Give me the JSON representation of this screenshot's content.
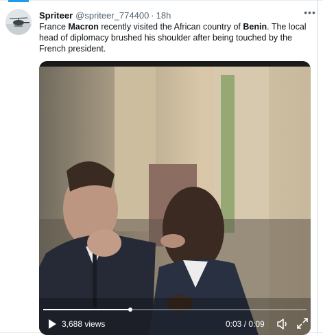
{
  "tweet": {
    "author_name": "Spriteer",
    "handle": "@spriteer_774400",
    "separator": "·",
    "time": "18h",
    "more_icon": "ellipsis-icon",
    "text_parts": {
      "p1": "France ",
      "b1": "Macron",
      "p2": " recently visited the African country of ",
      "b2": "Benin",
      "p3": ". The local head of diplomacy brushed his shoulder after being touched by the French president."
    }
  },
  "video": {
    "views": "3,688 views",
    "time_display": "0:03 / 0:09",
    "progress_fraction": 0.33,
    "icons": {
      "play": "play-icon",
      "volume": "volume-icon",
      "fullscreen": "fullscreen-icon"
    }
  },
  "colors": {
    "accent": "#1d9bf0",
    "text": "#0f1419",
    "secondary_text": "#536471"
  }
}
